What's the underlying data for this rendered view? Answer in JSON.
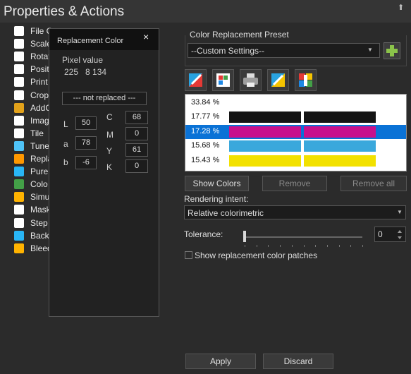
{
  "header": {
    "title": "Properties & Actions",
    "collapse_icon": "chevron-up-icon"
  },
  "tree": [
    {
      "label": "File C",
      "icon": "file-icon",
      "color": "#ffffff"
    },
    {
      "label": "Scale",
      "icon": "scale-icon",
      "color": "#ffffff"
    },
    {
      "label": "Rotat",
      "icon": "rotate-icon",
      "color": "#ffffff"
    },
    {
      "label": "Posit",
      "icon": "position-icon",
      "color": "#ffffff"
    },
    {
      "label": "Print",
      "icon": "print-icon",
      "color": "#ffffff"
    },
    {
      "label": "Crop",
      "icon": "crop-icon",
      "color": "#ffffff"
    },
    {
      "label": "AddC",
      "icon": "add-icon",
      "color": "#e3a21a"
    },
    {
      "label": "Imag",
      "icon": "image-icon",
      "color": "#ffffff"
    },
    {
      "label": "Tile",
      "icon": "tile-icon",
      "color": "#ffffff"
    },
    {
      "label": "Tune",
      "icon": "tune-icon",
      "color": "#4fc3f7"
    },
    {
      "label": "Repla",
      "icon": "replace-icon",
      "color": "#ff9800"
    },
    {
      "label": "Pure",
      "icon": "pure-icon",
      "color": "#29b6f6"
    },
    {
      "label": "Colo",
      "icon": "color-icon",
      "color": "#43a047"
    },
    {
      "label": "Simu",
      "icon": "simulate-icon",
      "color": "#ffb300"
    },
    {
      "label": "Mask",
      "icon": "mask-icon",
      "color": "#ffffff"
    },
    {
      "label": "Step",
      "icon": "step-icon",
      "color": "#ffffff"
    },
    {
      "label": "Back",
      "icon": "back-icon",
      "color": "#29b6f6"
    },
    {
      "label": "Bleed",
      "icon": "bleed-icon",
      "color": "#ffb300"
    }
  ],
  "popup": {
    "title": "Replacement Color",
    "close": "×",
    "pixel_label": "Pixel value",
    "pixel_values": "225   8 134",
    "replaced_status": "--- not replaced ---",
    "lab": [
      {
        "label": "L",
        "value": "50"
      },
      {
        "label": "a",
        "value": "78"
      },
      {
        "label": "b",
        "value": "-6"
      }
    ],
    "cmyk": [
      {
        "label": "C",
        "value": "68"
      },
      {
        "label": "M",
        "value": "0"
      },
      {
        "label": "Y",
        "value": "61"
      },
      {
        "label": "K",
        "value": "0"
      }
    ]
  },
  "preset": {
    "legend": "Color Replacement Preset",
    "value": "--Custom Settings--"
  },
  "tools": [
    {
      "icon": "edit-color-icon"
    },
    {
      "icon": "swatch-icon"
    },
    {
      "icon": "printer-icon"
    },
    {
      "icon": "measure-icon"
    },
    {
      "icon": "color-separation-icon"
    }
  ],
  "color_list": [
    {
      "pct": "33.84 %",
      "colors": [
        "#ffffff",
        "#ffffff"
      ],
      "selected": false
    },
    {
      "pct": "17.77 %",
      "colors": [
        "#141414",
        "#141414"
      ],
      "selected": false
    },
    {
      "pct": "17.28 %",
      "colors": [
        "#c8108c",
        "#c8108c"
      ],
      "selected": true
    },
    {
      "pct": "15.68 %",
      "colors": [
        "#3aa8dc",
        "#3aa8dc"
      ],
      "selected": false
    },
    {
      "pct": "15.43 %",
      "colors": [
        "#f2e100",
        "#f2e100"
      ],
      "selected": false
    }
  ],
  "buttons": {
    "show_colors": "Show Colors",
    "remove": "Remove",
    "remove_all": "Remove all",
    "apply": "Apply",
    "discard": "Discard"
  },
  "rendering": {
    "label": "Rendering intent:",
    "value": "Relative colorimetric"
  },
  "tolerance": {
    "label": "Tolerance:",
    "value": "0"
  },
  "show_patches": {
    "label": "Show replacement color patches",
    "checked": false
  }
}
